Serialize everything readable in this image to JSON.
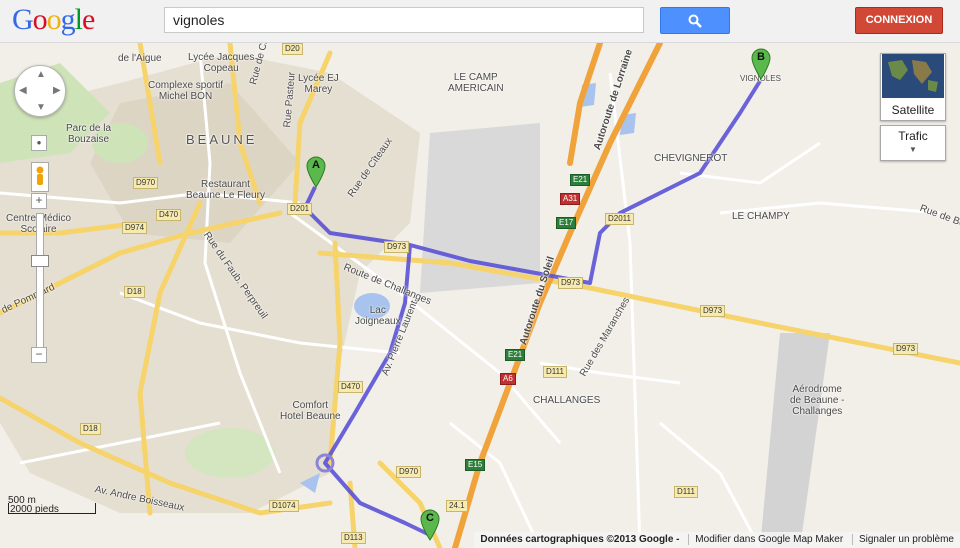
{
  "header": {
    "logo_letters": [
      {
        "char": "G",
        "color": "#3369e8"
      },
      {
        "char": "o",
        "color": "#d50f25"
      },
      {
        "char": "o",
        "color": "#eeb211"
      },
      {
        "char": "g",
        "color": "#3369e8"
      },
      {
        "char": "l",
        "color": "#009925"
      },
      {
        "char": "e",
        "color": "#d50f25"
      }
    ],
    "search_value": "vignoles",
    "search_button_icon": "search-icon",
    "signin_label": "CONNEXION"
  },
  "map_type": {
    "satellite_label": "Satellite",
    "traffic_label": "Trafic"
  },
  "markers": [
    {
      "letter": "A"
    },
    {
      "letter": "B"
    },
    {
      "letter": "C"
    }
  ],
  "labels": {
    "beaune": "BEAUNE",
    "lycee_jacques": "Lycée Jacques",
    "copeau": "Copeau",
    "lycee_ej": "Lycée EJ",
    "marey": "Marey",
    "le_camp": "LE CAMP",
    "americain": "AMERICAIN",
    "complexe": "Complexe sportif",
    "michel_bon": "Michel BON",
    "parc": "Parc de la",
    "bouzaise": "Bouzaise",
    "restaurant": "Restaurant",
    "le_fleury": "Beaune Le Fleury",
    "centre_medico": "Centre Médico",
    "scolaire": "Scolaire",
    "rue_aigue": "de l'Aigue",
    "rue_chorey": "Rue de Chorey",
    "rue_pasteur": "Rue Pasteur",
    "rue_citeaux": "Rue de Cîteaux",
    "rue_faub": "Rue du Faub. Perpreuil",
    "route_challanges": "Route de Challanges",
    "pommard": "de Pommard",
    "lac": "Lac",
    "joigneaux": "Joigneaux",
    "pierre_laurent": "Av. Pierre Laurent",
    "comfort": "Comfort",
    "hotel_beaune": "Hotel Beaune",
    "andre_boisseaux": "Av. Andre Boisseaux",
    "autoroute_lorraine": "Autoroute de Lorraine",
    "autoroute_soleil": "Autoroute du Soleil",
    "chevignerot": "CHEVIGNEROT",
    "le_champy": "LE CHAMPY",
    "rue_de_bo": "Rue de Bo",
    "vignoles_place": "VIGNOLES",
    "rue_maranches": "Rue des Maranches",
    "challanges": "CHALLANGES",
    "aerodrome1": "Aérodrome",
    "aerodrome2": "de Beaune -",
    "aerodrome3": "Challanges"
  },
  "road_shields": {
    "d20": "D20",
    "d970a": "D970",
    "d974": "D974",
    "d470": "D470",
    "d18a": "D18",
    "d18b": "D18",
    "d201": "D201",
    "d973a": "D973",
    "d973b": "D973",
    "d973c": "D973",
    "d973d": "D973",
    "d111a": "D111",
    "d111b": "D111",
    "d970b": "D970",
    "d1074": "D1074",
    "d113": "D113",
    "d2011": "D2011",
    "e21a": "E21",
    "e21b": "E21",
    "a31": "A31",
    "e17": "E17",
    "a6": "A6",
    "e15": "E15",
    "e24": "24.1"
  },
  "scale": {
    "metric": "500 m",
    "imperial": "2000 pieds"
  },
  "footer": {
    "copyright": "Données cartographiques ©2013 Google -",
    "edit_link": "Modifier dans Google Map Maker",
    "report_link": "Signaler un problème"
  },
  "colors": {
    "route": "#5a52d6",
    "motorway": "#f1a33b",
    "major_road": "#f6d36b",
    "water": "#a7c3ee",
    "urban": "#ddd6c6"
  }
}
